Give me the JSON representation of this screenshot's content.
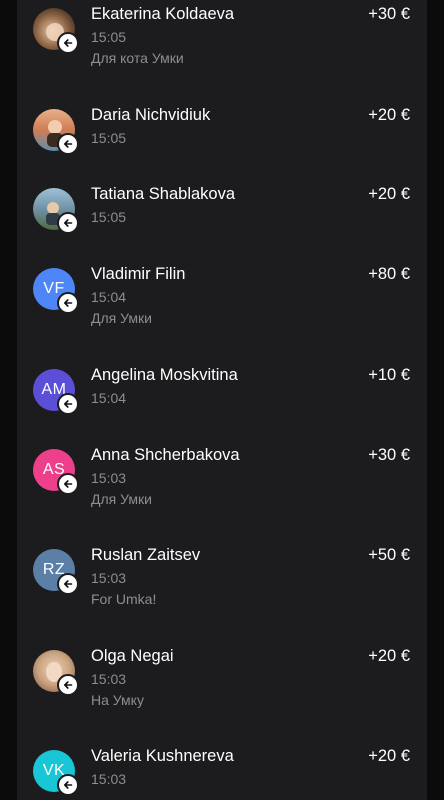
{
  "transactions": [
    {
      "name": "Ekaterina Koldaeva",
      "time": "15:05",
      "note": "Для кота Умки",
      "amount": "+30 €",
      "avatar": {
        "type": "photo",
        "initials": "",
        "color": "#a07850"
      }
    },
    {
      "name": "Daria Nichvidiuk",
      "time": "15:05",
      "note": "",
      "amount": "+20 €",
      "avatar": {
        "type": "photo",
        "initials": "",
        "color": "#c98a5a"
      }
    },
    {
      "name": "Tatiana Shablakova",
      "time": "15:05",
      "note": "",
      "amount": "+20 €",
      "avatar": {
        "type": "photo",
        "initials": "",
        "color": "#7d93a6"
      }
    },
    {
      "name": "Vladimir Filin",
      "time": "15:04",
      "note": "Для Умки",
      "amount": "+80 €",
      "avatar": {
        "type": "initials",
        "initials": "VF",
        "color": "#4f86f7"
      }
    },
    {
      "name": "Angelina Moskvitina",
      "time": "15:04",
      "note": "",
      "amount": "+10 €",
      "avatar": {
        "type": "initials",
        "initials": "AM",
        "color": "#5b4fd8"
      }
    },
    {
      "name": "Anna Shcherbakova",
      "time": "15:03",
      "note": "Для Умки",
      "amount": "+30 €",
      "avatar": {
        "type": "initials",
        "initials": "AS",
        "color": "#ee3f8a"
      }
    },
    {
      "name": "Ruslan Zaitsev",
      "time": "15:03",
      "note": "For Umka!",
      "amount": "+50 €",
      "avatar": {
        "type": "initials",
        "initials": "RZ",
        "color": "#5c7fa8"
      }
    },
    {
      "name": "Olga Negai",
      "time": "15:03",
      "note": "На Умку",
      "amount": "+20 €",
      "avatar": {
        "type": "photo",
        "initials": "",
        "color": "#c9a989"
      }
    },
    {
      "name": "Valeria Kushnereva",
      "time": "15:03",
      "note": "",
      "amount": "+20 €",
      "avatar": {
        "type": "initials",
        "initials": "VK",
        "color": "#18c6d6"
      }
    }
  ],
  "icons": {
    "incoming": "arrow-left-icon"
  }
}
